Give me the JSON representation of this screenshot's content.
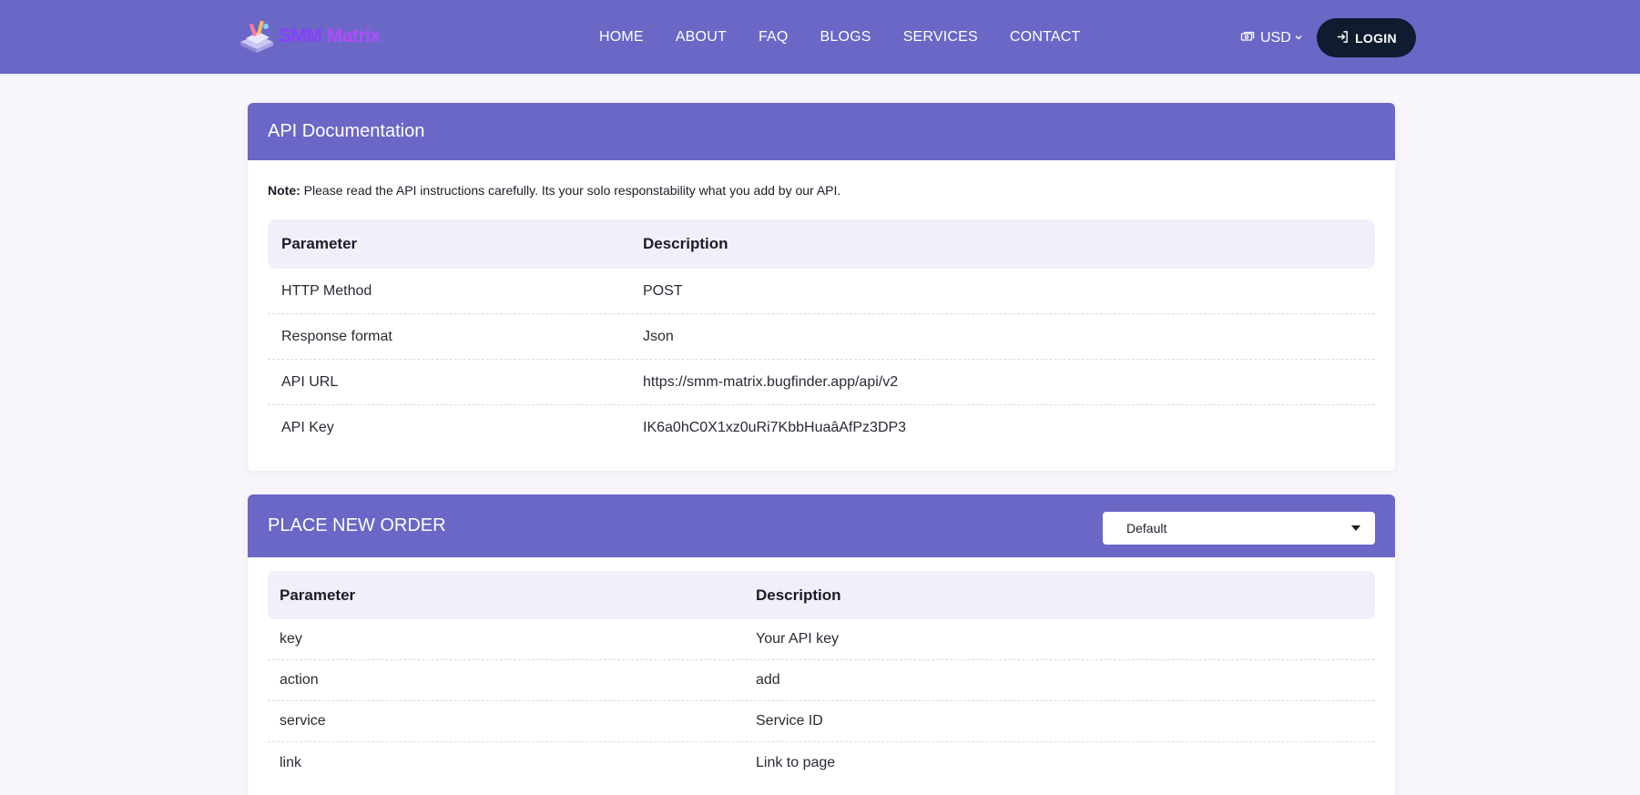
{
  "brand": {
    "logo_part1": "SMM ",
    "logo_part2": "Matrix"
  },
  "nav": {
    "links": [
      "HOME",
      "ABOUT",
      "FAQ",
      "BLOGS",
      "SERVICES",
      "CONTACT"
    ],
    "currency": "USD",
    "login": "LOGIN"
  },
  "api_card": {
    "title": "API Documentation",
    "note_label": "Note:",
    "note_text": " Please read the API instructions carefully. Its your solo responstability what you add by our API.",
    "headers": [
      "Parameter",
      "Description"
    ],
    "rows": [
      [
        "HTTP Method",
        "POST"
      ],
      [
        "Response format",
        "Json"
      ],
      [
        "API URL",
        "https://smm-matrix.bugfinder.app/api/v2"
      ],
      [
        "API Key",
        "IK6a0hC0X1xz0uRi7KbbHuaâAfPz3DP3"
      ]
    ]
  },
  "order_card": {
    "title": "PLACE NEW ORDER",
    "select_value": "Default",
    "headers": [
      "Parameter",
      "Description"
    ],
    "rows": [
      [
        "key",
        "Your API key"
      ],
      [
        "action",
        "add"
      ],
      [
        "service",
        "Service ID"
      ],
      [
        "link",
        "Link to page"
      ]
    ]
  },
  "colors": {
    "primary": "#6b67c7",
    "login_bg": "#0f1b2e",
    "table_head_bg": "#f0f0fa",
    "page_bg": "#f6f6fb"
  }
}
